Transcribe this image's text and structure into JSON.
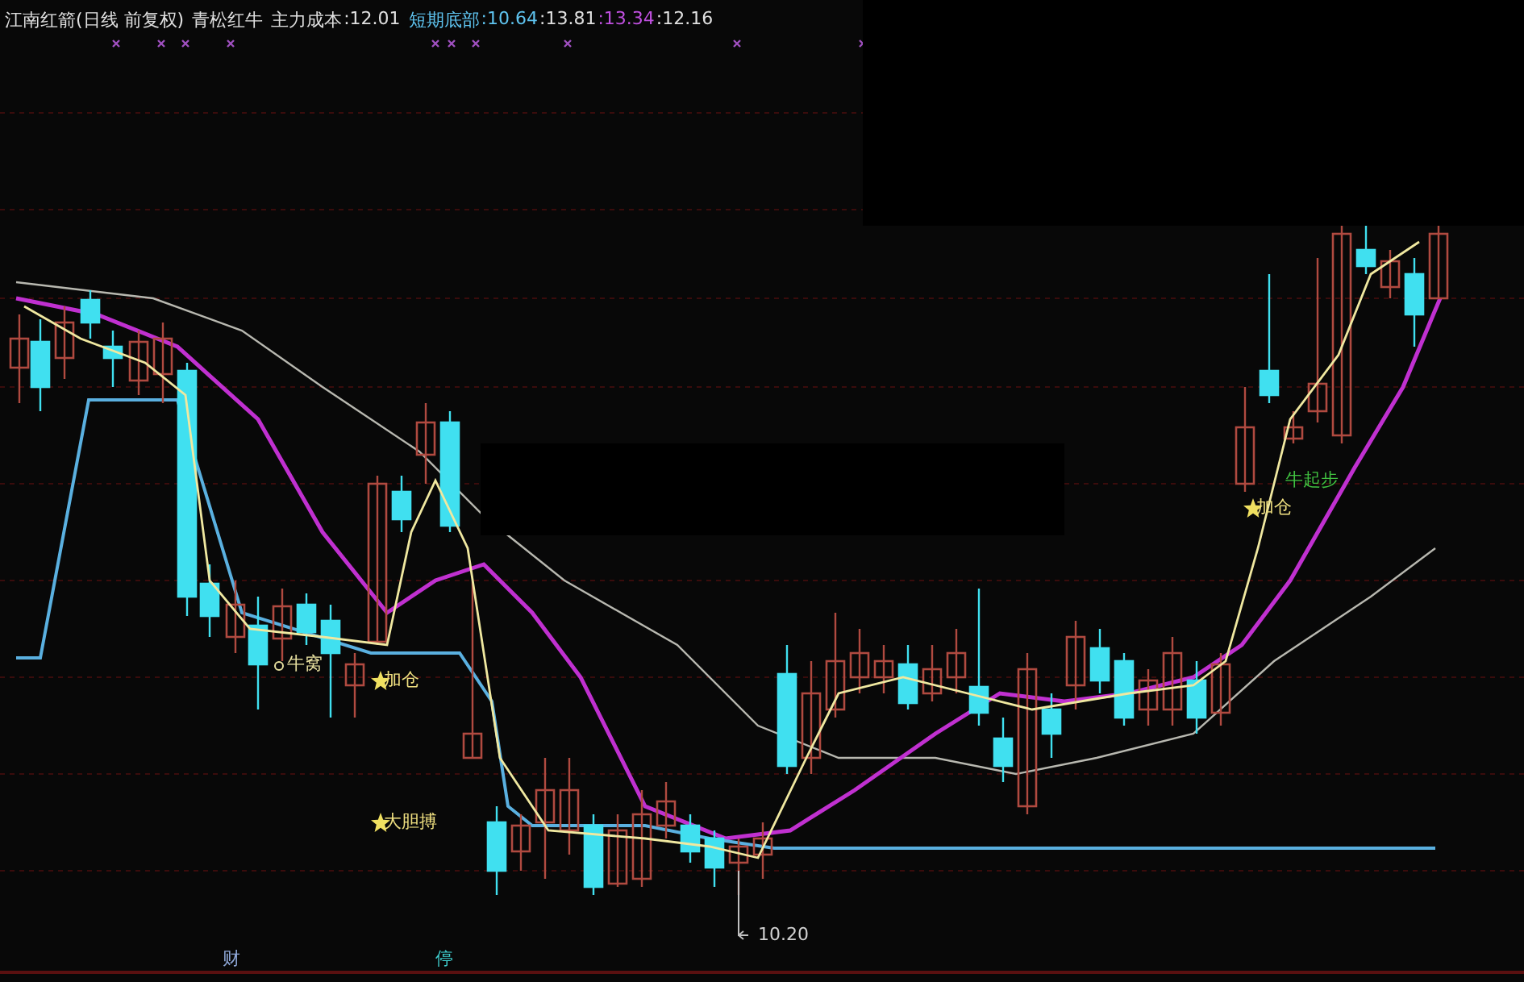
{
  "legend": {
    "title": "江南红箭(日线 前复权)",
    "indicator": "青松红牛",
    "items": [
      {
        "label": "主力成本",
        "value": ":12.01",
        "color": "#e0e0e0"
      },
      {
        "label": "短期底部",
        "value": ":10.64",
        "color": "#5fc4f0"
      },
      {
        "value": ":13.81",
        "color": "#e0e0e0"
      },
      {
        "value": ":13.34",
        "color": "#c050e0"
      },
      {
        "value": ":12.16",
        "color": "#e0e0e0"
      }
    ]
  },
  "annotations": [
    {
      "kind": "circle",
      "text": "牛窝"
    },
    {
      "kind": "star",
      "text": "加仓"
    },
    {
      "kind": "star",
      "text": "大胆搏"
    },
    {
      "kind": "star",
      "text": "加仓"
    },
    {
      "kind": "plain",
      "text": "牛起步"
    },
    {
      "kind": "arrow",
      "text": "10.20"
    }
  ],
  "bottom_markers": [
    {
      "text": "财",
      "color": "#8fa8d8"
    },
    {
      "text": "停",
      "color": "#40d0d0"
    }
  ]
}
